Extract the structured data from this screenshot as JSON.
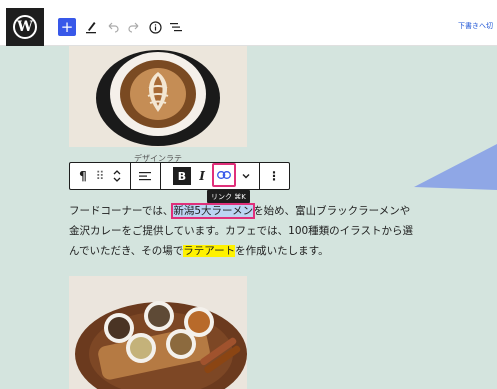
{
  "toolbar": {
    "add_label": "+",
    "draft_label": "下書きへ切"
  },
  "icons": {
    "wp_logo": "wordpress-logo",
    "pen": "pen-icon",
    "undo": "undo-icon",
    "redo": "redo-icon",
    "info": "info-icon",
    "outline": "list-view-icon"
  },
  "image1": {
    "caption": "デザインラテ"
  },
  "block_toolbar": {
    "paragraph_icon": "¶",
    "drag_icon": "⠿",
    "move_icon": "⌃",
    "align_icon": "≡",
    "bold_label": "B",
    "italic_label": "I",
    "more_icon": "⋮",
    "tooltip": "リンク  ⌘K"
  },
  "paragraph": {
    "line1_pre": "フードコーナーでは、",
    "line1_link": "新潟5大ラーメン",
    "line1_post": "を始め、富山ブラックラーメンや",
    "line2": "金沢カレーをご提供しています。カフェでは、100種類のイラストから選",
    "line3_pre": "んでいただき、その場で",
    "line3_highlight": "ラテアート",
    "line3_post": "を作成いたします。"
  },
  "colors": {
    "canvas_bg": "#d4e4de",
    "accent_blue": "#3858e9",
    "link_border": "#e0307a",
    "highlight_yellow": "#fff200",
    "pointer": "#8fa7e6"
  }
}
